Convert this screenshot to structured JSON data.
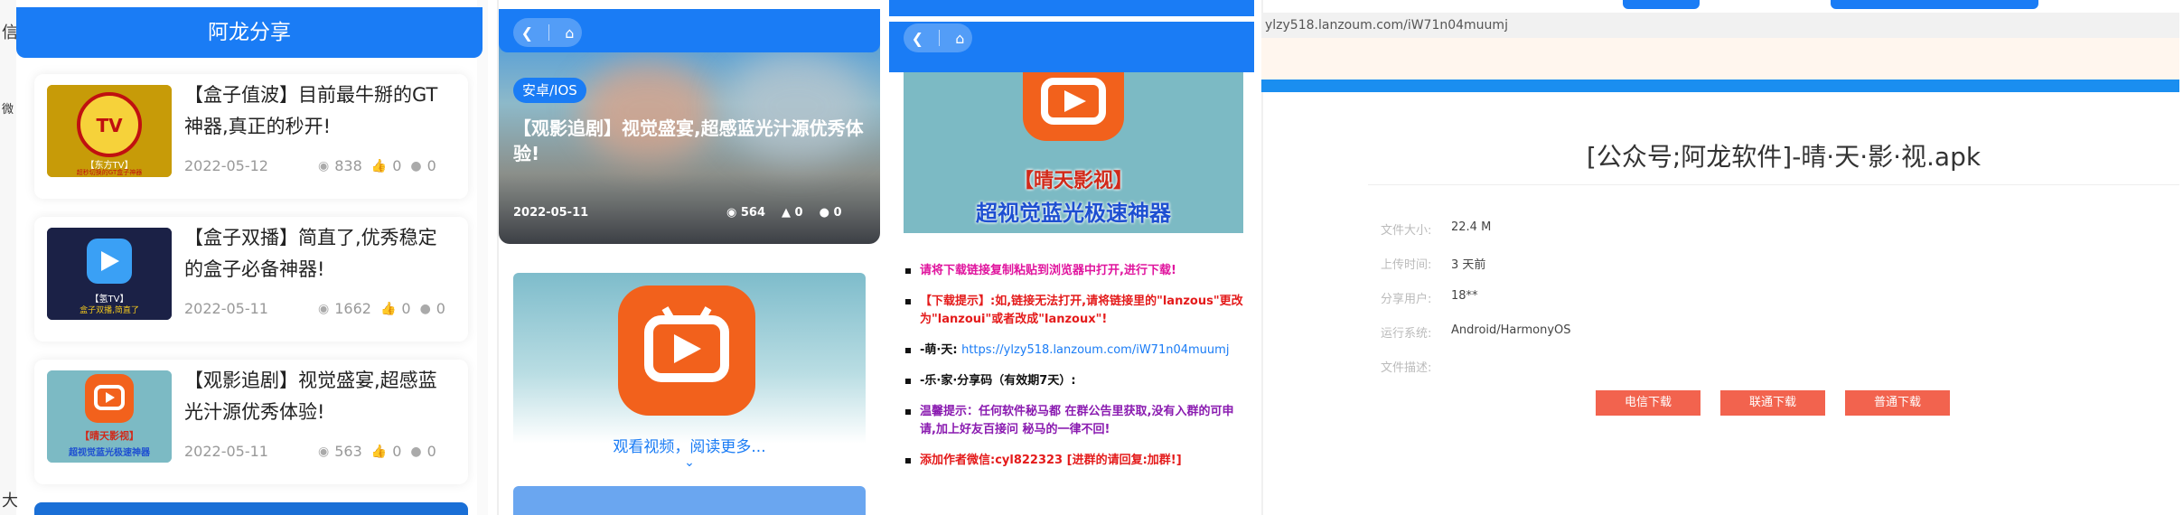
{
  "panel1": {
    "header": "阿龙分享",
    "edge_chars": [
      "信",
      "微",
      "大"
    ],
    "right_edge_chars": [
      "信",
      "微",
      "大"
    ],
    "cards": [
      {
        "title": "【盒子值波】目前最牛掰的GT神器,真正的秒开!",
        "date": "2022-05-12",
        "views": "838",
        "likes": "0",
        "comments": "0",
        "thumb_label": "【东方TV】",
        "thumb_sub": "超秒切换的GT盒子神器"
      },
      {
        "title": "【盒子双播】简直了,优秀稳定的盒子必备神器!",
        "date": "2022-05-11",
        "views": "1662",
        "likes": "0",
        "comments": "0",
        "thumb_label": "【氢TV】",
        "thumb_sub": "盒子双播,简直了"
      },
      {
        "title": "【观影追剧】视觉盛宴,超感蓝光汁源优秀体验!",
        "date": "2022-05-11",
        "views": "563",
        "likes": "0",
        "comments": "0",
        "thumb_label": "【晴天影视】",
        "thumb_sub": "超视觉蓝光极速神器"
      }
    ]
  },
  "panel2": {
    "tag": "安卓/IOS",
    "title": "【观影追剧】视觉盛宴,超感蓝光汁源优秀体验!",
    "date": "2022-05-11",
    "views": "564",
    "likes": "0",
    "comments": "0",
    "readmore": "观看视频，阅读更多..."
  },
  "panel3": {
    "caption1": "【晴天影视】",
    "caption2": "超视觉蓝光极速神器",
    "items": [
      {
        "text": "请将下载链接复制粘贴到浏览器中打开,进行下载!",
        "color": "#e0159e"
      },
      {
        "text": "【下载提示】:如,链接无法打开,请将链接里的\"lanzous\"更改为\"lanzoui\"或者改成\"lanzoux\"!",
        "color": "#e41b1b"
      },
      {
        "text": "-萌·天:",
        "link": "https://ylzy518.lanzoum.com/iW71n04muumj",
        "color": "#111111"
      },
      {
        "text": "-乐·家·分享码（有效期7天）:",
        "color": "#111111"
      },
      {
        "text": "温馨提示：任何软件秘马都  在群公告里获取,没有入群的可申请,加上好友百接问  秘马的一律不回!",
        "color": "#8a1bb0"
      },
      {
        "text": "添加作者微信:cyl822323 [进群的请回复:加群!]",
        "color": "#e41b1b"
      }
    ]
  },
  "panel4": {
    "url": "ylzy518.lanzoum.com/iW71n04muumj",
    "title": "[公众号;阿龙软件]-晴·天·影·视.apk",
    "info": [
      {
        "k": "文件大小:",
        "v": "22.4 M"
      },
      {
        "k": "上传时间:",
        "v": "3 天前"
      },
      {
        "k": "分享用户:",
        "v": "18**"
      },
      {
        "k": "运行系统:",
        "v": "Android/HarmonyOS"
      },
      {
        "k": "文件描述:",
        "v": ""
      }
    ],
    "buttons": [
      "电信下载",
      "联通下载",
      "普通下载"
    ]
  }
}
